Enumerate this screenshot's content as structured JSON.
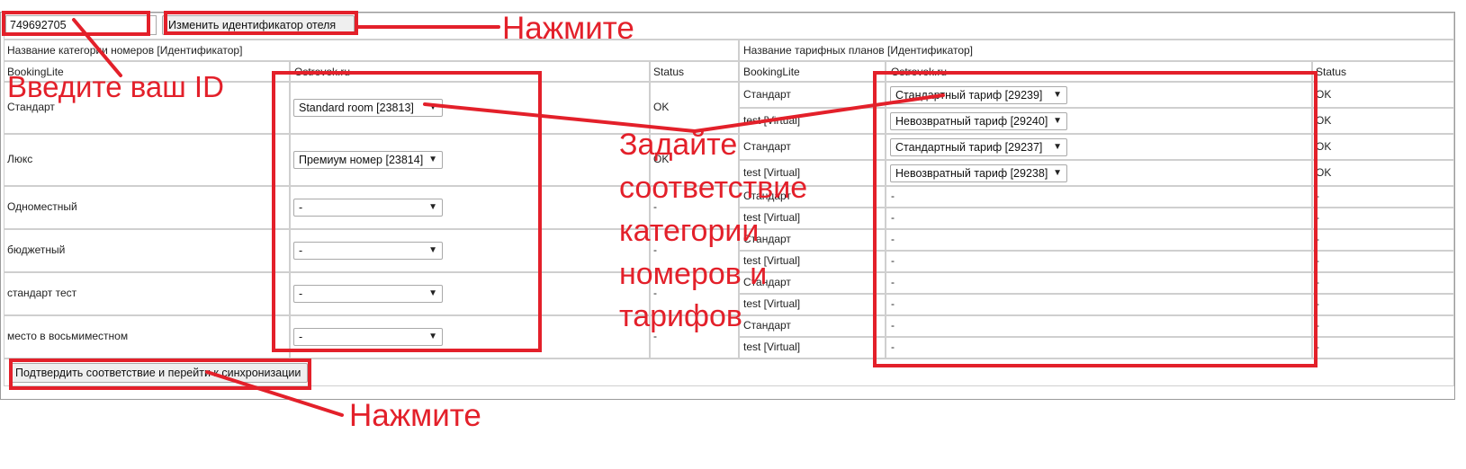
{
  "hotel_id": {
    "value": "749692705",
    "change_button": "Изменить идентификатор отеля"
  },
  "left_table": {
    "header": "Название категории номеров [Идентификатор]",
    "col_bookinglite": "BookingLite",
    "col_ostrovok": "Ostrovok.ru",
    "col_status": "Status",
    "rows": [
      {
        "name": "Стандарт",
        "select": "Standard room [23813]",
        "status": "OK"
      },
      {
        "name": "Люкс",
        "select": "Премиум номер [23814]",
        "status": "OK"
      },
      {
        "name": "Одноместный",
        "select": "-",
        "status": "-"
      },
      {
        "name": "бюджетный",
        "select": "-",
        "status": "-"
      },
      {
        "name": "стандарт тест",
        "select": "-",
        "status": "-"
      },
      {
        "name": "место в восьмиместном",
        "select": "-",
        "status": "-"
      }
    ]
  },
  "right_table": {
    "header": "Название тарифных планов [Идентификатор]",
    "col_bookinglite": "BookingLite",
    "col_ostrovok": "Ostrovok.ru",
    "col_status": "Status",
    "rows": [
      {
        "name": "Стандарт",
        "value": "Стандартный тариф [29239]",
        "status": "OK"
      },
      {
        "name": "test [Virtual]",
        "value": "Невозвратный тариф [29240]",
        "status": "OK"
      },
      {
        "name": "Стандарт",
        "value": "Стандартный тариф [29237]",
        "status": "OK"
      },
      {
        "name": "test [Virtual]",
        "value": "Невозвратный тариф [29238]",
        "status": "OK"
      },
      {
        "name": "Стандарт",
        "value": "-",
        "status": "-"
      },
      {
        "name": "test [Virtual]",
        "value": "-",
        "status": "-"
      },
      {
        "name": "Стандарт",
        "value": "-",
        "status": "-"
      },
      {
        "name": "test [Virtual]",
        "value": "-",
        "status": "-"
      },
      {
        "name": "Стандарт",
        "value": "-",
        "status": "-"
      },
      {
        "name": "test [Virtual]",
        "value": "-",
        "status": "-"
      },
      {
        "name": "Стандарт",
        "value": "-",
        "status": "-"
      },
      {
        "name": "test [Virtual]",
        "value": "-",
        "status": "-"
      }
    ]
  },
  "confirm_button": "Подтвердить соответствие и перейти к синхронизации",
  "annotations": {
    "press_top": "Нажмите",
    "enter_id": "Введите ваш ID",
    "map_lines": [
      "Задайте",
      "соответствие",
      "категории",
      "номеров и",
      "тарифов"
    ],
    "press_bottom": "Нажмите",
    "color": "#e3202a"
  }
}
